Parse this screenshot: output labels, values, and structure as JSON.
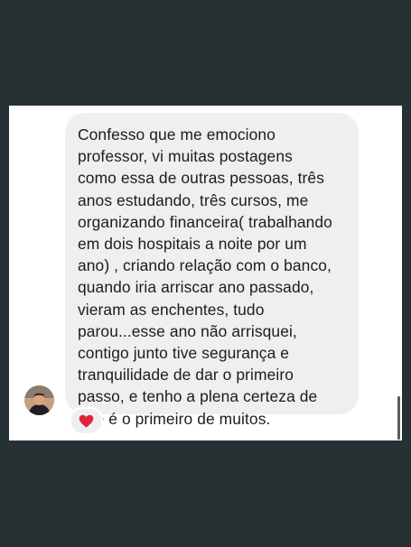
{
  "thread": {
    "message_text": "Confesso que me emociono\nprofessor, vi muitas postagens\ncomo essa de outras pessoas, três\nanos estudando, três cursos, me\norganizando financeira( trabalhando\nem dois hospitais a noite por um\nano) , criando relação com o banco,\nquando iria arriscar ano passado,\nvieram as enchentes, tudo\nparou...esse ano não arrisquei,\ncontigo junto tive segurança e\ntranquilidade de dar o primeiro\npasso, e tenho a plena certeza de\nque é o primeiro de muitos.",
    "reaction": {
      "icon": "heart-icon",
      "color": "#e0223a"
    }
  },
  "colors": {
    "background": "#263134",
    "bubble": "#efefef",
    "text": "#1c1c1c"
  }
}
